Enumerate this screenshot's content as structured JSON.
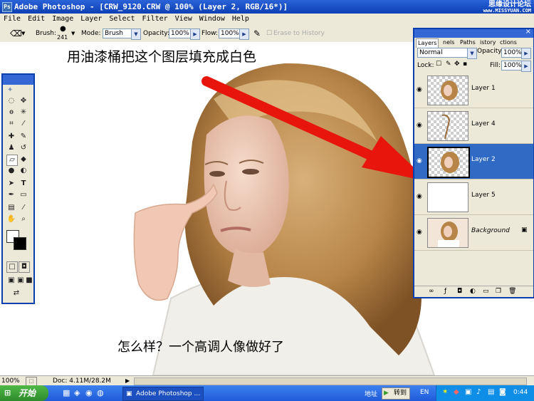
{
  "window": {
    "title": "Adobe Photoshop - [CRW_9120.CRW @ 100% (Layer 2, RGB/16*)]",
    "watermark_line1": "思缘设计论坛",
    "watermark_line2": "www.MISSYUAN.COM"
  },
  "menu": [
    "File",
    "Edit",
    "Image",
    "Layer",
    "Select",
    "Filter",
    "View",
    "Window",
    "Help"
  ],
  "options": {
    "brush_label": "Brush:",
    "brush_size": "241",
    "mode_label": "Mode:",
    "mode_value": "Brush",
    "opacity_label": "Opacity:",
    "opacity_value": "100%",
    "flow_label": "Flow:",
    "flow_value": "100%",
    "erase_history": "Erase to History"
  },
  "annotations": {
    "top": "用油漆桶把这个图层填充成白色",
    "bottom": "怎么样？一个高调人像做好了"
  },
  "layers_panel": {
    "tabs": [
      "Layers",
      "nels",
      "Paths",
      "istory",
      "ctions"
    ],
    "blend_mode": "Normal",
    "opacity_label": "Opacity:",
    "opacity_value": "100%",
    "lock_label": "Lock:",
    "fill_label": "Fill:",
    "fill_value": "100%",
    "layers": [
      {
        "name": "Layer 1",
        "selected": false
      },
      {
        "name": "Layer 4",
        "selected": false
      },
      {
        "name": "Layer 2",
        "selected": true
      },
      {
        "name": "Layer 5",
        "selected": false
      },
      {
        "name": "Background",
        "selected": false
      }
    ]
  },
  "status": {
    "zoom": "100%",
    "doc": "Doc: 4.11M/28.2M"
  },
  "taskbar": {
    "start": "开始",
    "task": "Adobe Photoshop ...",
    "address": "地址",
    "go": "转到",
    "lang": "EN",
    "time": "0:44"
  },
  "colors": {
    "arrow": "#e8150c",
    "selected_layer": "#316ac5",
    "titlebar": "#0c3fb4"
  }
}
